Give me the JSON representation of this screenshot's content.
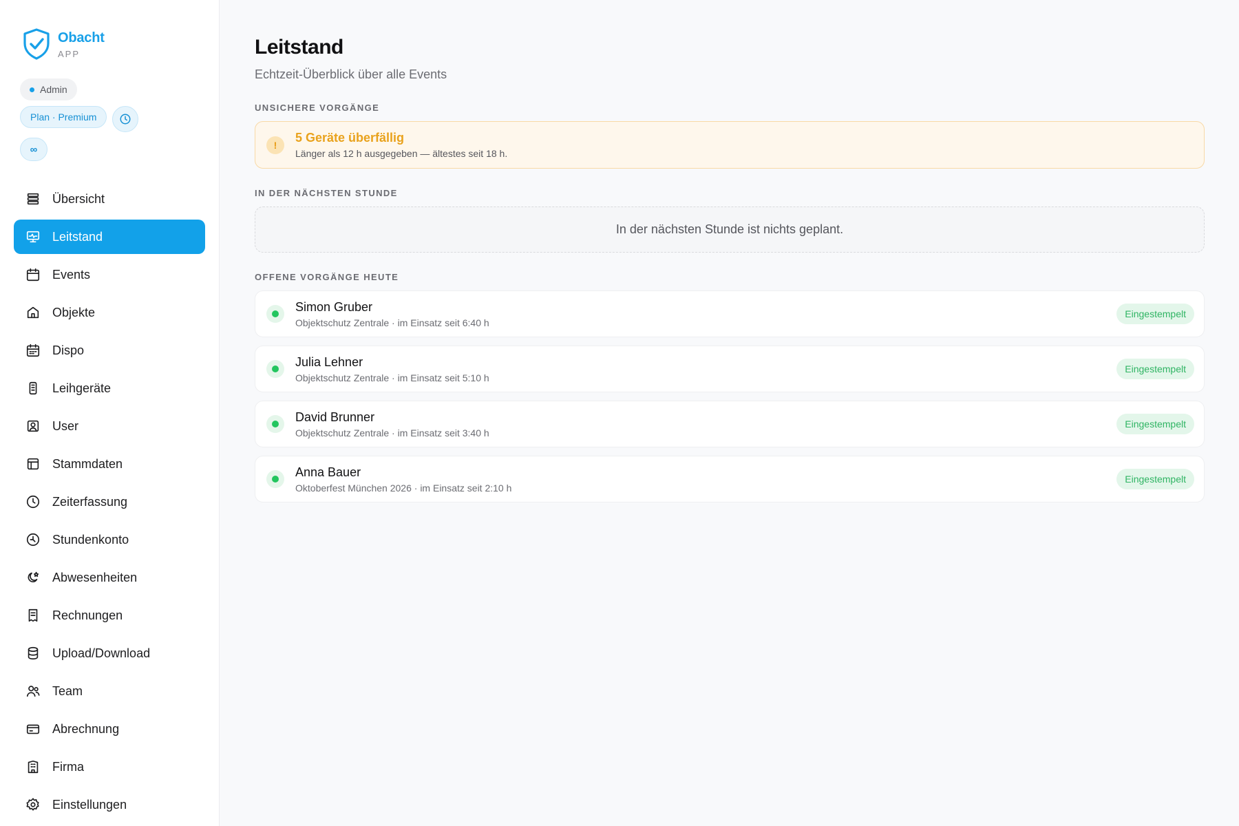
{
  "brand": {
    "name": "Obacht",
    "sub": "APP"
  },
  "chips": {
    "role": "Admin",
    "plan": "Plan · Premium",
    "infinity": "∞"
  },
  "nav": [
    {
      "label": "Übersicht",
      "icon": "layers-icon"
    },
    {
      "label": "Leitstand",
      "icon": "monitor-icon",
      "active": true
    },
    {
      "label": "Events",
      "icon": "calendar-icon"
    },
    {
      "label": "Objekte",
      "icon": "home-icon"
    },
    {
      "label": "Dispo",
      "icon": "calendar-grid-icon"
    },
    {
      "label": "Leihgeräte",
      "icon": "device-icon"
    },
    {
      "label": "User",
      "icon": "user-square-icon"
    },
    {
      "label": "Stammdaten",
      "icon": "layout-icon"
    },
    {
      "label": "Zeiterfassung",
      "icon": "clock-icon"
    },
    {
      "label": "Stundenkonto",
      "icon": "clock-history-icon"
    },
    {
      "label": "Abwesenheiten",
      "icon": "moon-star-icon"
    },
    {
      "label": "Rechnungen",
      "icon": "receipt-icon"
    },
    {
      "label": "Upload/Download",
      "icon": "database-icon"
    },
    {
      "label": "Team",
      "icon": "users-icon"
    },
    {
      "label": "Abrechnung",
      "icon": "credit-card-icon"
    },
    {
      "label": "Firma",
      "icon": "building-icon"
    },
    {
      "label": "Einstellungen",
      "icon": "gear-icon"
    }
  ],
  "page": {
    "title": "Leitstand",
    "subtitle": "Echtzeit-Überblick über alle Events"
  },
  "sections": {
    "unsafe": "UNSICHERE VORGÄNGE",
    "next_hour": "IN DER NÄCHSTEN STUNDE",
    "open_today": "OFFENE VORGÄNGE HEUTE"
  },
  "warning": {
    "icon": "!",
    "title": "5 Geräte überfällig",
    "text": "Länger als 12 h ausgegeben — ältestes seit 18 h."
  },
  "next_hour_empty": "In der nächsten Stunde ist nichts geplant.",
  "open_items": [
    {
      "name": "Simon Gruber",
      "detail": "Objektschutz Zentrale · im Einsatz seit 6:40 h",
      "status": "Eingestempelt"
    },
    {
      "name": "Julia Lehner",
      "detail": "Objektschutz Zentrale · im Einsatz seit 5:10 h",
      "status": "Eingestempelt"
    },
    {
      "name": "David Brunner",
      "detail": "Objektschutz Zentrale · im Einsatz seit 3:40 h",
      "status": "Eingestempelt"
    },
    {
      "name": "Anna Bauer",
      "detail": "Oktoberfest München 2026 · im Einsatz seit 2:10 h",
      "status": "Eingestempelt"
    }
  ],
  "colors": {
    "accent": "#12a1e9",
    "warning": "#e9a21c",
    "success": "#22c55e"
  }
}
